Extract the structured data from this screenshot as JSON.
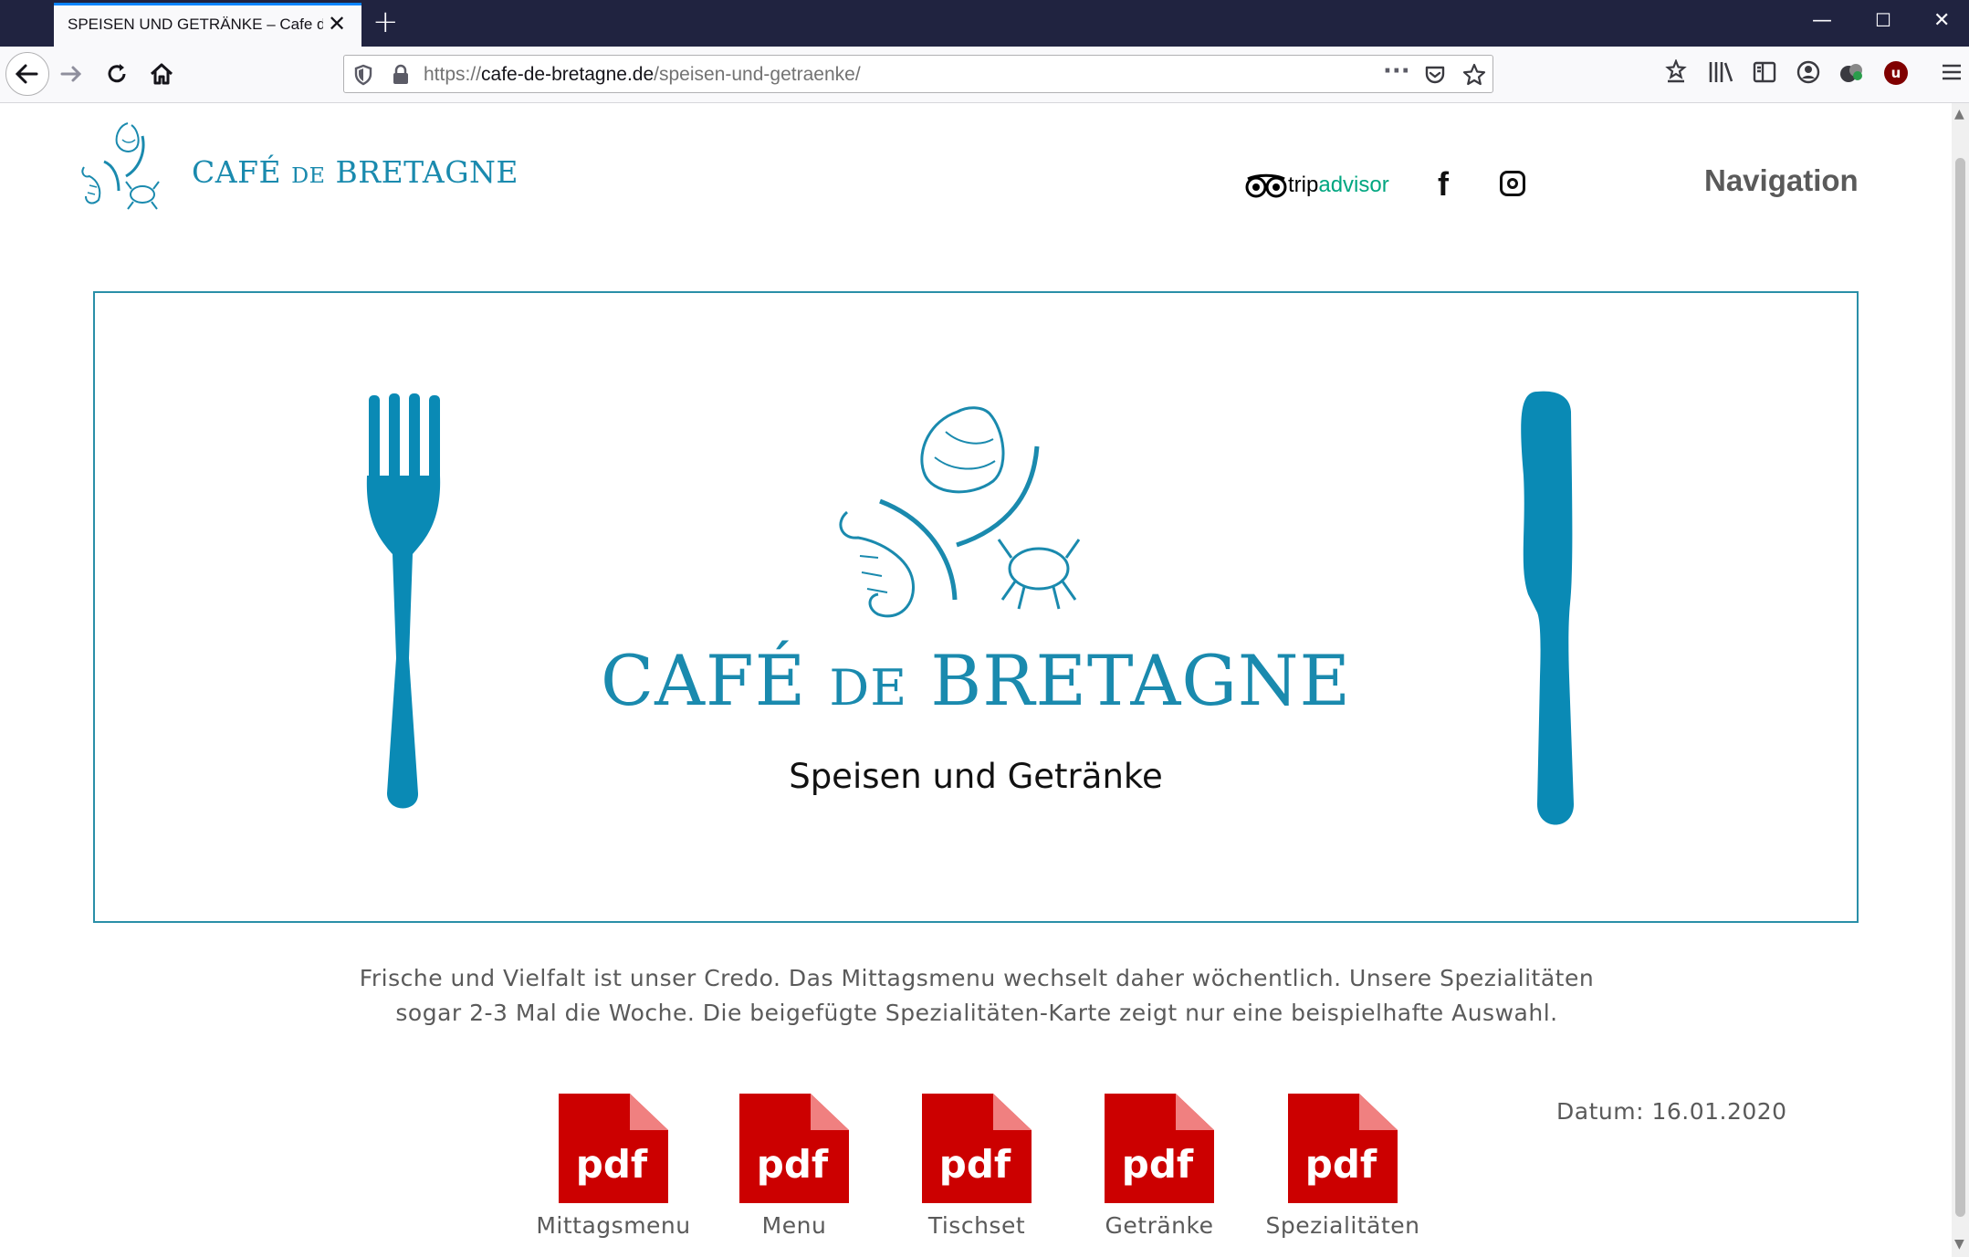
{
  "browser": {
    "tab_title": "SPEISEN UND GETRÄNKE – Cafe de",
    "url_prefix": "https://",
    "url_host": "cafe-de-bretagne.de",
    "url_path": "/speisen-und-getraenke/"
  },
  "header": {
    "logo_text_1": "CAFÉ",
    "logo_text_de": "DE",
    "logo_text_2": "BRETAGNE",
    "tripadvisor_trip": "trip",
    "tripadvisor_advisor": "advisor",
    "facebook_glyph": "f",
    "navigation_label": "Navigation"
  },
  "hero": {
    "title_1": "CAFÉ",
    "title_de": "DE",
    "title_2": "BRETAGNE",
    "subtitle": "Speisen und Getränke"
  },
  "intro": {
    "line1": "Frische und Vielfalt ist unser Credo. Das Mittagsmenu wechselt daher wöchentlich. Unsere Spezialitäten",
    "line2": "sogar 2-3 Mal die Woche. Die beigefügte Spezialitäten-Karte zeigt nur eine beispielhafte Auswahl."
  },
  "pdf_icon_text": "pdf",
  "downloads": [
    {
      "label": "Mittagsmenu"
    },
    {
      "label": "Menu"
    },
    {
      "label": "Tischset"
    },
    {
      "label": "Getränke"
    },
    {
      "label": "Spezialitäten"
    }
  ],
  "datum": "Datum: 16.01.2020",
  "colors": {
    "brand_teal": "#1a8aae",
    "pdf_red": "#cc0000",
    "tab_bar": "#202340"
  }
}
